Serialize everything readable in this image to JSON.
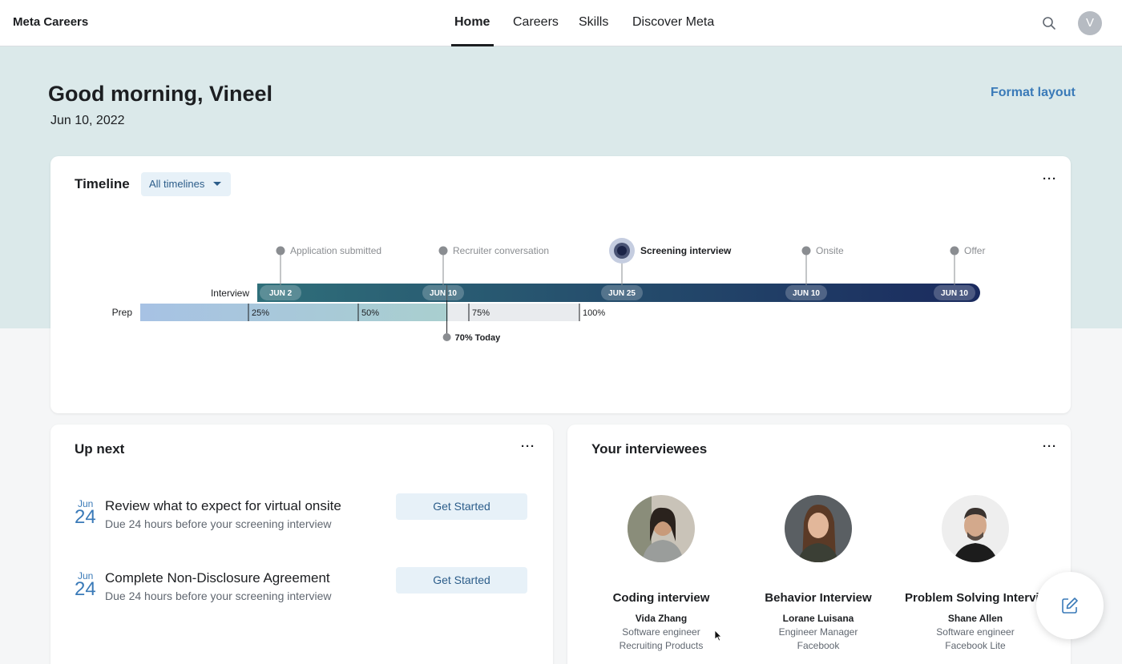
{
  "nav": {
    "brand": "Meta Careers",
    "links": [
      "Home",
      "Careers",
      "Skills",
      "Discover Meta"
    ],
    "active": "Home",
    "avatar_initial": "V",
    "search_icon": "search-icon"
  },
  "header": {
    "greeting": "Good morning, Vineel",
    "date": "Jun 10, 2022",
    "format_layout": "Format layout"
  },
  "timeline": {
    "title": "Timeline",
    "filter": "All timelines",
    "row_labels": [
      "Interview",
      "Prep"
    ],
    "milestones": [
      {
        "label": "Application submitted",
        "date": "JUN 2",
        "active": false
      },
      {
        "label": "Recruiter conversation",
        "date": "JUN 10",
        "active": false
      },
      {
        "label": "Screening interview",
        "date": "JUN 25",
        "active": true
      },
      {
        "label": "Onsite",
        "date": "JUN 10",
        "active": false
      },
      {
        "label": "Offer",
        "date": "JUN 10",
        "active": false
      }
    ],
    "prep_ticks": [
      "25%",
      "50%",
      "75%",
      "100%"
    ],
    "prep_progress": 0.7,
    "today_label": "70% Today",
    "colors": {
      "bar_start": "#2f6f7a",
      "bar_end": "#1a2a5e",
      "prep_fill": "#a7c2e4",
      "prep_track": "#e9ebee"
    }
  },
  "up_next": {
    "title": "Up next",
    "tasks": [
      {
        "month": "Jun",
        "day": "24",
        "title": "Review what to expect for virtual onsite",
        "subtitle": "Due 24 hours before your screening interview",
        "button": "Get Started"
      },
      {
        "month": "Jun",
        "day": "24",
        "title": "Complete Non-Disclosure Agreement",
        "subtitle": "Due 24 hours before your screening interview",
        "button": "Get Started"
      }
    ]
  },
  "interviewees": {
    "title": "Your interviewees",
    "people": [
      {
        "type": "Coding interview",
        "name": "Vida Zhang",
        "role": "Software engineer",
        "team": "Recruiting Products"
      },
      {
        "type": "Behavior Interview",
        "name": "Lorane Luisana",
        "role": "Engineer Manager",
        "team": "Facebook"
      },
      {
        "type": "Problem Solving Intervie",
        "name": "Shane Allen",
        "role": "Software engineer",
        "team": "Facebook Lite"
      }
    ]
  },
  "fab_icon": "compose-icon"
}
